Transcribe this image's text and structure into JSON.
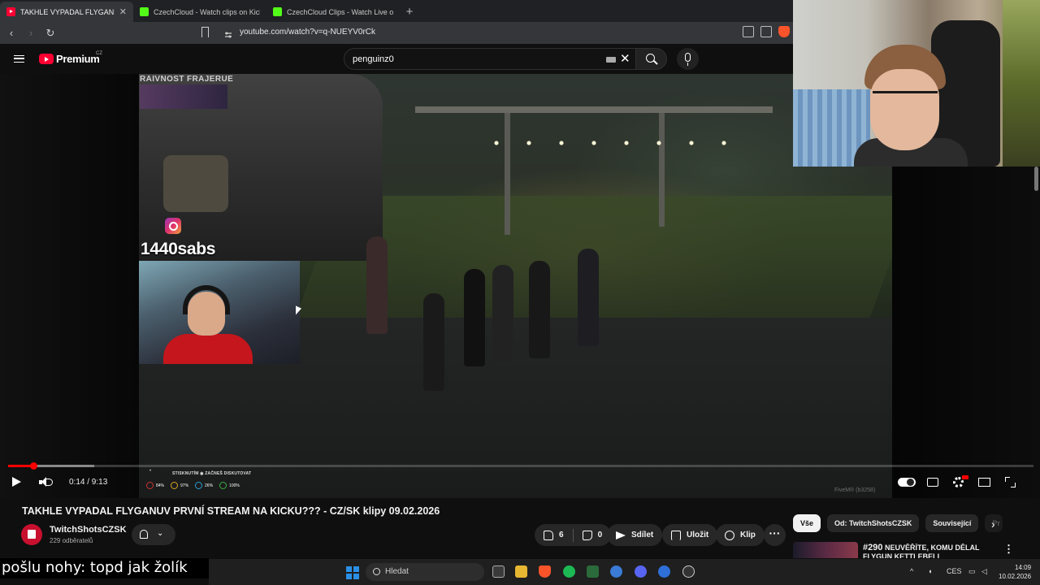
{
  "browser": {
    "tabs": [
      {
        "title": "TAKHLE VYPADAL FLYGANUV",
        "icon": "youtube-favicon",
        "active": true
      },
      {
        "title": "CzechCloud - Watch clips on Kick",
        "icon": "kick-favicon",
        "active": false
      },
      {
        "title": "CzechCloud Clips - Watch Live on Kic",
        "icon": "kick-favicon",
        "active": false
      }
    ],
    "url": "youtube.com/watch?v=q-NUEYV0rCk"
  },
  "header": {
    "logo_text": "Premium",
    "logo_country": "CZ",
    "search_value": "penguinz0"
  },
  "video": {
    "overlay_label": "RAIVNOST FRAJERUE",
    "instagram_handle": "1440sabs",
    "hud_prompt": "STISKNUTÍM ◉ ZAČNEŠ DISKUTOVAT",
    "hud_stats": [
      "84%",
      "97%",
      "26%",
      "100%"
    ],
    "fivem_tag": "FiveM® (b3258)",
    "hud_mark": "•",
    "current_time": "0:14",
    "duration": "9:13",
    "time_display": "0:14 / 9:13",
    "progress_played": 0.025,
    "progress_buffered": 0.084
  },
  "info": {
    "title": "TAKHLE VYPADAL FLYGANUV PRVNÍ STREAM NA KICKU??? - CZ/SK klipy 09.02.2026",
    "channel": "TwitchShotsCZSK",
    "subscribers": "229 odběratelů",
    "likes": "6",
    "dislikes": "0",
    "share_label": "Sdílet",
    "save_label": "Uložit",
    "clip_label": "Klip",
    "more_label": "···"
  },
  "sidebar": {
    "chips": [
      "Vše",
      "Od: TwitchShotsCZSK",
      "Související",
      "Pr"
    ],
    "related": {
      "badge": "#290",
      "title": "NEUVĚŘÍTE, KOMU DĚLAL FLYGUN KETTLEBELL"
    }
  },
  "subtitle": "pošlu nohy: topd jak žolík",
  "taskbar": {
    "search_label": "Hledat",
    "language": "CES",
    "time": "14:09",
    "date": "10.02.2026"
  },
  "colors": {
    "accent": "#ff0000",
    "background": "#0f0f0f",
    "kick": "#53fc18",
    "youtube": "#ff0033"
  }
}
